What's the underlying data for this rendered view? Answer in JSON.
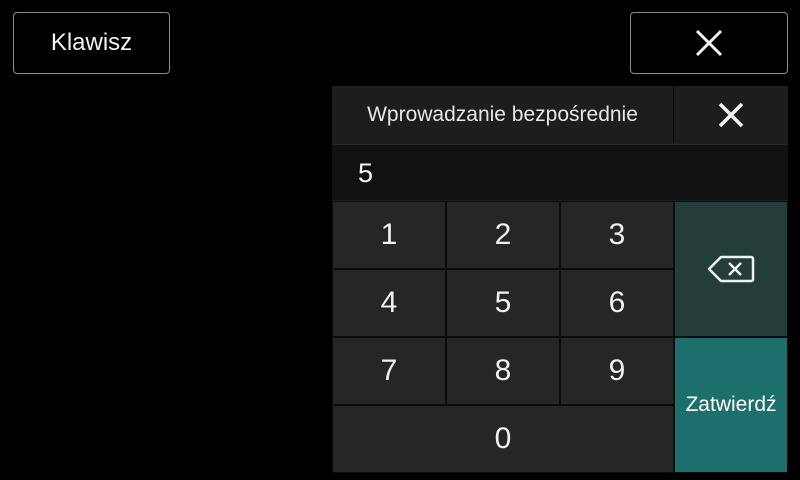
{
  "top_bar": {
    "keyboard_label": "Klawisz",
    "close_icon": "close-icon"
  },
  "panel": {
    "title": "Wprowadzanie bezpośrednie",
    "close_icon": "close-icon",
    "input_value": "5"
  },
  "keypad": {
    "keys": [
      "1",
      "2",
      "3",
      "4",
      "5",
      "6",
      "7",
      "8",
      "9",
      "0"
    ],
    "backspace_icon": "backspace-icon",
    "confirm_label": "Zatwierdź"
  },
  "colors": {
    "background": "#000000",
    "key": "#262626",
    "backspace": "#233d3b",
    "confirm": "#1c6f6a"
  }
}
